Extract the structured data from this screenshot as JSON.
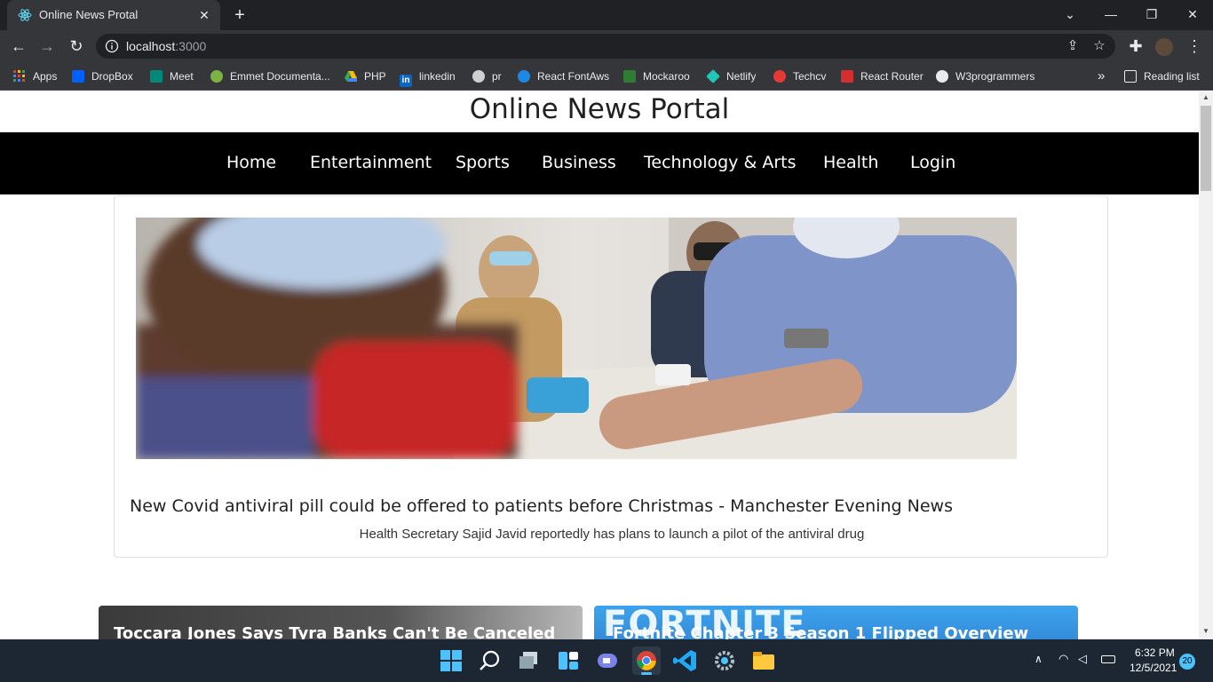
{
  "browser": {
    "tab_title": "Online News Protal",
    "tab_close": "✕",
    "new_tab": "+",
    "url_host": "localhost",
    "url_port": ":3000",
    "bookmarks": [
      {
        "label": "Apps",
        "icon": "apps-grid-icon",
        "color": "#ea4335"
      },
      {
        "label": "DropBox",
        "icon": "dropbox-icon",
        "color": "#0061fe"
      },
      {
        "label": "Meet",
        "icon": "google-meet-icon",
        "color": "#00897b"
      },
      {
        "label": "Emmet Documenta...",
        "icon": "emmet-icon",
        "color": "#7cb342"
      },
      {
        "label": "PHP",
        "icon": "google-drive-icon",
        "color": "#fbbc04"
      },
      {
        "label": "linkedin",
        "icon": "linkedin-icon",
        "color": "#0a66c2"
      },
      {
        "label": "pr",
        "icon": "pr-icon",
        "color": "#cfcfcf"
      },
      {
        "label": "React FontAws",
        "icon": "react-icon",
        "color": "#1e88e5"
      },
      {
        "label": "Mockaroo",
        "icon": "mockaroo-icon",
        "color": "#2e7d32"
      },
      {
        "label": "Netlify",
        "icon": "netlify-icon",
        "color": "#20c6b7"
      },
      {
        "label": "Techcv",
        "icon": "techcv-icon",
        "color": "#e53935"
      },
      {
        "label": "React Router",
        "icon": "react-router-icon",
        "color": "#d32f2f"
      },
      {
        "label": "W3programmers",
        "icon": "wordpress-icon",
        "color": "#e8eaed"
      }
    ],
    "overflow": "»",
    "reading_list": "Reading list"
  },
  "page": {
    "site_title": "Online News Portal",
    "nav": [
      "Home",
      "Entertainment",
      "Sports",
      "Business",
      "Technology & Arts",
      "Health",
      "Login"
    ],
    "featured": {
      "headline": "New Covid antiviral pill could be offered to patients before Christmas - Manchester Evening News",
      "summary": "Health Secretary Sajid Javid reportedly has plans to launch a pilot of the antiviral drug"
    },
    "tiles": [
      {
        "title": "Toccara Jones Says Tyra Banks Can't Be Canceled"
      },
      {
        "title": "Fortnite Chapter 3 Season 1 Flipped Overview",
        "logo": "FORTNITE"
      }
    ]
  },
  "taskbar": {
    "time": "6:32 PM",
    "date": "12/5/2021",
    "notifications": "20"
  },
  "colors": {
    "nav_bg": "#000000",
    "chrome_dark": "#202124",
    "chrome_tab": "#35363a",
    "taskbar_bg": "#1c2733"
  }
}
